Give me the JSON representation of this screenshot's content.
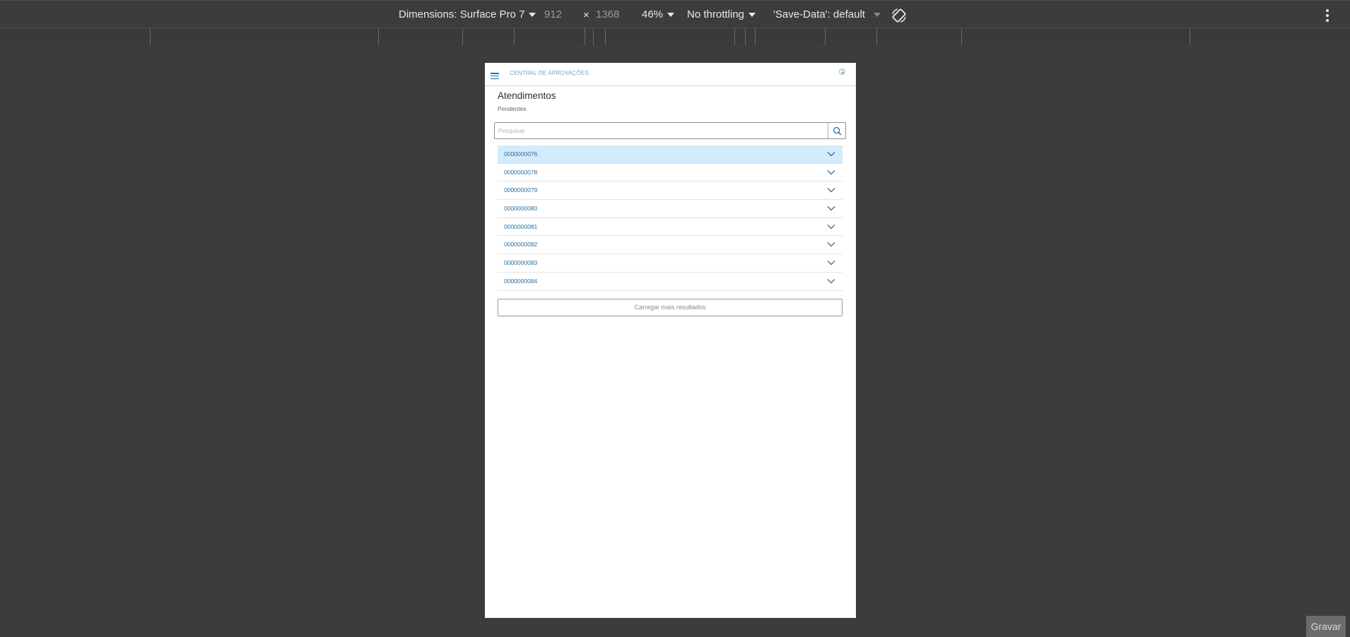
{
  "devtools": {
    "dimensions_label": "Dimensions: Surface Pro 7",
    "width_value": "912",
    "times": "×",
    "height_value": "1368",
    "zoom": "46%",
    "throttling": "No throttling",
    "save_data": "'Save-Data': default",
    "icons": [
      "rotate-icon",
      "more-options-icon"
    ]
  },
  "app": {
    "header_title": "CENTRAL DE APROVAÇÕES",
    "page_title": "Atendimentos",
    "page_subtitle": "Pendentes",
    "search": {
      "placeholder": "Pesquisar",
      "value": ""
    },
    "items": [
      {
        "code": "0000000076",
        "selected": true
      },
      {
        "code": "0000000078"
      },
      {
        "code": "0000000079"
      },
      {
        "code": "0000000080"
      },
      {
        "code": "0000000081"
      },
      {
        "code": "0000000082"
      },
      {
        "code": "0000000083"
      },
      {
        "code": "0000000084"
      }
    ],
    "load_more_label": "Carregar mais resultados",
    "colors": {
      "accent": "#2a6fa0",
      "selected_row": "#d3ebfb"
    }
  },
  "footer": {
    "record_label": "Gravar"
  }
}
